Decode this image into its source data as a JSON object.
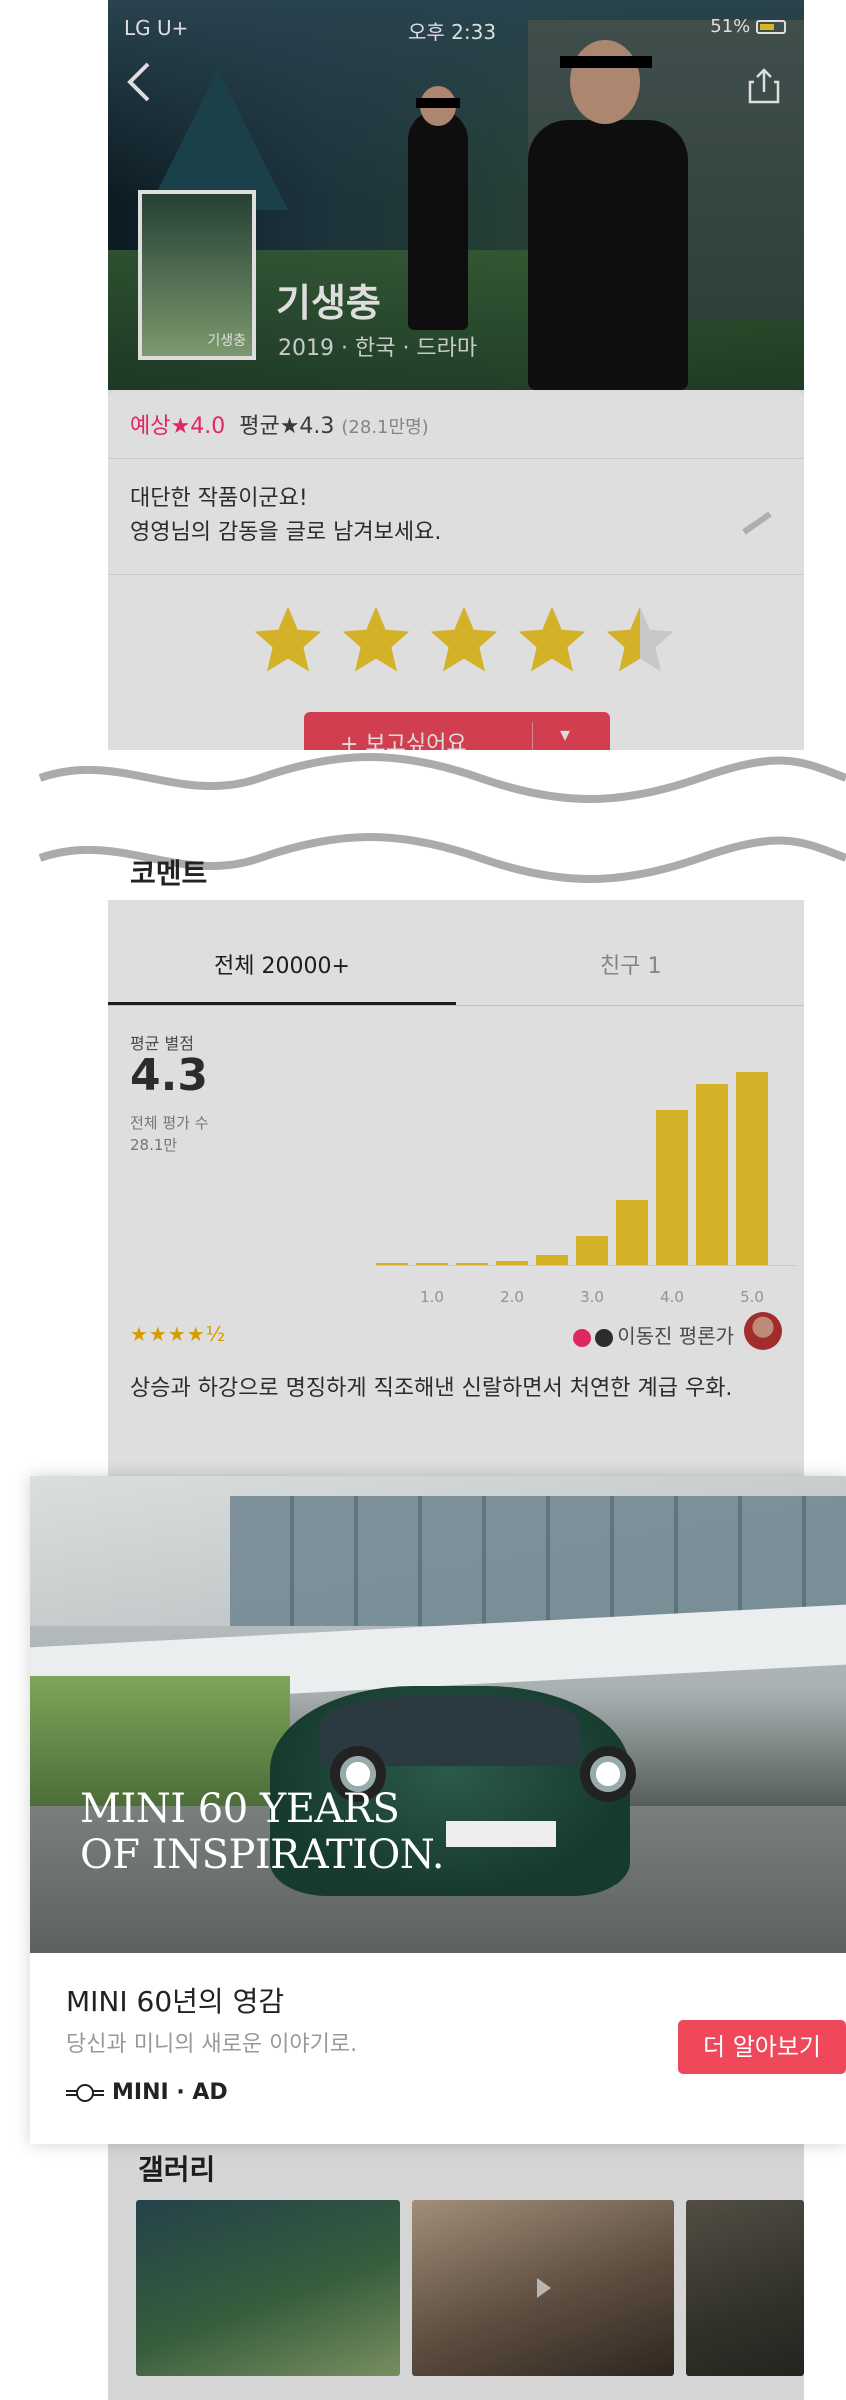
{
  "status_bar": {
    "carrier": "LG U+",
    "time": "오후 2:33",
    "battery": "51%"
  },
  "movie": {
    "title": "기생충",
    "meta": "2019 · 한국 · 드라마",
    "poster_text": "기생충"
  },
  "rating": {
    "expected_label": "예상",
    "expected": "★4.0",
    "average_label": "평균",
    "average": "★4.3",
    "count": "(28.1만명)",
    "prompt_line1": "대단한 작품이군요!",
    "prompt_line2": "영영님의 감동을 글로 남겨보세요.",
    "user_stars": 4.5,
    "wishlist_button": "+ 보고싶어요"
  },
  "comments": {
    "title": "코멘트",
    "tabs": [
      {
        "label": "전체 20000+"
      },
      {
        "label": "친구 1"
      }
    ],
    "avg_label": "평균 별점",
    "avg_value": "4.3",
    "total_label": "전체 평가 수",
    "total_value": "28.1만"
  },
  "chart_data": {
    "type": "bar",
    "categories": [
      "0.5",
      "1.0",
      "1.5",
      "2.0",
      "2.5",
      "3.0",
      "3.5",
      "4.0",
      "4.5",
      "5.0"
    ],
    "values": [
      1,
      1,
      1,
      2,
      5,
      14,
      31,
      74,
      86,
      92
    ],
    "tick_labels": [
      "1.0",
      "2.0",
      "3.0",
      "4.0",
      "5.0"
    ],
    "title": "",
    "xlabel": "",
    "ylabel": "",
    "ylim": [
      0,
      100
    ]
  },
  "review": {
    "stars": "★★★★½",
    "reviewer": "이동진 평론가",
    "text": "상승과 하강으로 명징하게 직조해낸 신랄하면서 처연한 계급 우화."
  },
  "ad": {
    "headline_line1": "MINI 60 YEARS",
    "headline_line2": "OF INSPIRATION.",
    "title": "MINI 60년의 영감",
    "subtitle": "당신과 미니의 새로운 이야기로.",
    "button": "더 알아보기",
    "brand": "MINI · AD"
  },
  "gallery": {
    "title": "갤러리"
  },
  "colors": {
    "accent": "#f0485b",
    "pink": "#ff2f6e",
    "star": "#f4cd2e"
  }
}
